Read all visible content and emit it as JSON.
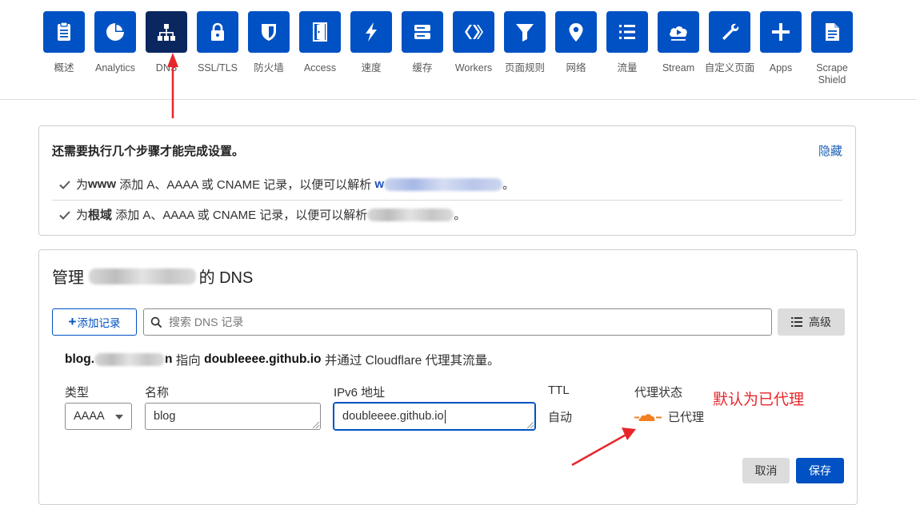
{
  "nav": {
    "items": [
      {
        "label": "概述",
        "icon": "clipboard-icon"
      },
      {
        "label": "Analytics",
        "icon": "pie-chart-icon"
      },
      {
        "label": "DNS",
        "icon": "network-icon",
        "active": true
      },
      {
        "label": "SSL/TLS",
        "icon": "lock-icon"
      },
      {
        "label": "防火墙",
        "icon": "shield-icon"
      },
      {
        "label": "Access",
        "icon": "door-icon"
      },
      {
        "label": "速度",
        "icon": "lightning-icon"
      },
      {
        "label": "缓存",
        "icon": "server-icon"
      },
      {
        "label": "Workers",
        "icon": "workers-icon"
      },
      {
        "label": "页面规则",
        "icon": "filter-icon"
      },
      {
        "label": "网络",
        "icon": "location-pin-icon"
      },
      {
        "label": "流量",
        "icon": "list-icon"
      },
      {
        "label": "Stream",
        "icon": "cloud-play-icon"
      },
      {
        "label": "自定义页面",
        "icon": "wrench-icon"
      },
      {
        "label": "Apps",
        "icon": "plus-icon"
      },
      {
        "label": "Scrape Shield",
        "icon": "document-icon"
      }
    ]
  },
  "setup": {
    "title": "还需要执行几个步骤才能完成设置。",
    "hide_label": "隐藏",
    "step1": {
      "prefix": "为 ",
      "emph": "www",
      "suffix": " 添加 A、AAAA 或 CNAME 记录，以便可以解析 ",
      "link_start": "w",
      "end": "。"
    },
    "step2": {
      "prefix": "为 ",
      "emph": "根域",
      "suffix": " 添加 A、AAAA 或 CNAME 记录，以便可以解析",
      "end": "。"
    }
  },
  "dns": {
    "title_prefix": "管理 ",
    "title_suffix": "的 DNS",
    "add_record_label": "添加记录",
    "search_placeholder": "搜索 DNS 记录",
    "advanced_label": "高级",
    "record_desc": {
      "name_start": "blog.",
      "name_end": "n",
      "points_to": " 指向 ",
      "target": "doubleeee.github.io",
      "proxied_text": " 并通过 Cloudflare 代理其流量。"
    },
    "form": {
      "type_label": "类型",
      "name_label": "名称",
      "ipv6_label": "IPv6 地址",
      "ttl_label": "TTL",
      "proxy_label": "代理状态",
      "type_value": "AAAA",
      "name_value": "blog",
      "ipv6_value": "doubleeee.github.io",
      "ttl_value": "自动",
      "proxy_value": "已代理"
    },
    "annotation": "默认为已代理",
    "cancel_label": "取消",
    "save_label": "保存"
  },
  "colors": {
    "brand_blue": "#0051c3",
    "active_tile": "#0a2760",
    "annotation_red": "#e8262a",
    "proxy_orange": "#f38020"
  }
}
